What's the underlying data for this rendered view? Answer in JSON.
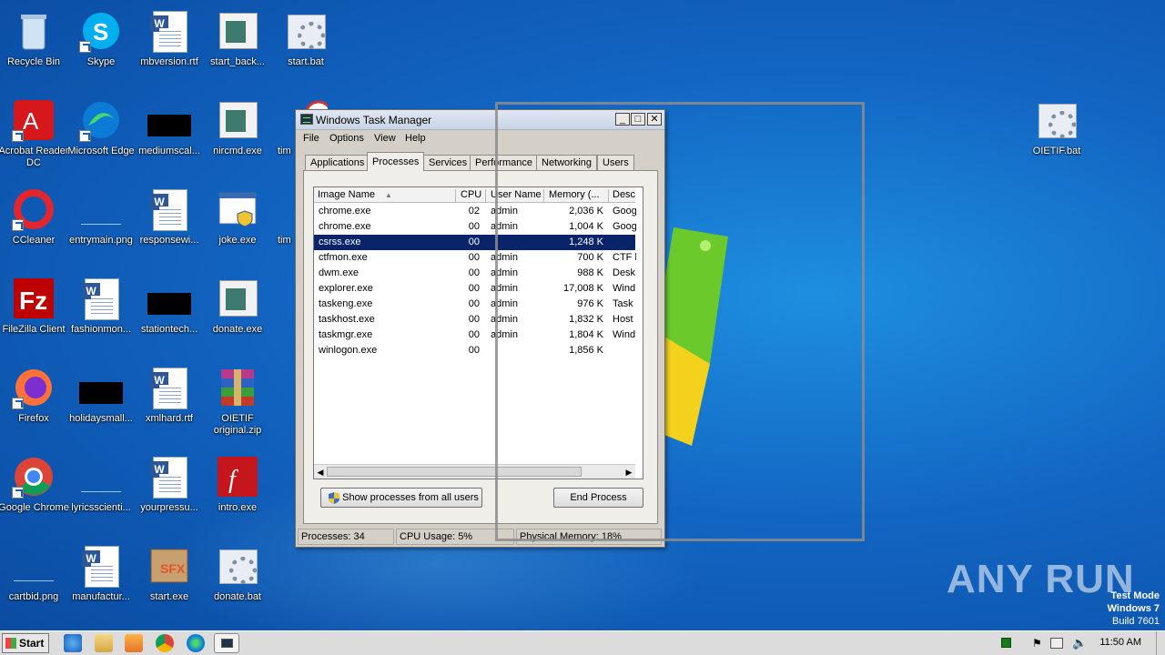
{
  "desktop": {
    "icons": [
      {
        "label": "Recycle Bin",
        "icon": "recycle-bin-icon"
      },
      {
        "label": "Skype",
        "icon": "skype-icon"
      },
      {
        "label": "mbversion.rtf",
        "icon": "word-document-icon"
      },
      {
        "label": "start_back...",
        "icon": "image-file-icon"
      },
      {
        "label": "start.bat",
        "icon": "batch-file-icon"
      },
      {
        "label": "Acrobat Reader DC",
        "icon": "acrobat-icon"
      },
      {
        "label": "Microsoft Edge",
        "icon": "edge-icon"
      },
      {
        "label": "mediumscal...",
        "icon": "black-image-icon"
      },
      {
        "label": "nircmd.exe",
        "icon": "image-file-icon"
      },
      {
        "label": "tim",
        "icon": "clock-icon"
      },
      {
        "label": "CCleaner",
        "icon": "ccleaner-icon"
      },
      {
        "label": "entrymain.png",
        "icon": "png-file-icon"
      },
      {
        "label": "responsewi...",
        "icon": "word-document-icon"
      },
      {
        "label": "joke.exe",
        "icon": "exe-shield-icon"
      },
      {
        "label": "tim",
        "icon": "exe-icon"
      },
      {
        "label": "FileZilla Client",
        "icon": "filezilla-icon"
      },
      {
        "label": "fashionmon...",
        "icon": "word-document-icon"
      },
      {
        "label": "stationtech...",
        "icon": "black-image-icon"
      },
      {
        "label": "donate.exe",
        "icon": "image-file-icon"
      },
      {
        "label": "Firefox",
        "icon": "firefox-icon"
      },
      {
        "label": "holidaysmall...",
        "icon": "black-image-icon"
      },
      {
        "label": "xmlhard.rtf",
        "icon": "word-document-icon"
      },
      {
        "label": "OIETIF original.zip",
        "icon": "winrar-icon"
      },
      {
        "label": "Google Chrome",
        "icon": "chrome-icon"
      },
      {
        "label": "lyricsscienti...",
        "icon": "png-file-icon"
      },
      {
        "label": "yourpressu...",
        "icon": "word-document-icon"
      },
      {
        "label": "intro.exe",
        "icon": "flash-icon"
      },
      {
        "label": "cartbid.png",
        "icon": "png-file-icon"
      },
      {
        "label": "manufactur...",
        "icon": "word-document-icon"
      },
      {
        "label": "start.exe",
        "icon": "sfx-archive-icon"
      },
      {
        "label": "donate.bat",
        "icon": "batch-file-icon"
      },
      {
        "label": "OIETIF.bat",
        "icon": "batch-file-icon"
      }
    ]
  },
  "taskmanager": {
    "title": "Windows Task Manager",
    "menu": [
      "File",
      "Options",
      "View",
      "Help"
    ],
    "tabs": [
      "Applications",
      "Processes",
      "Services",
      "Performance",
      "Networking",
      "Users"
    ],
    "active_tab": "Processes",
    "columns": [
      "Image Name",
      "CPU",
      "User Name",
      "Memory (...",
      "Desc"
    ],
    "rows": [
      {
        "name": "chrome.exe",
        "cpu": "02",
        "user": "admin",
        "mem": "2,036 K",
        "desc": "Goog"
      },
      {
        "name": "chrome.exe",
        "cpu": "00",
        "user": "admin",
        "mem": "1,004 K",
        "desc": "Goog"
      },
      {
        "name": "csrss.exe",
        "cpu": "00",
        "user": "",
        "mem": "1,248 K",
        "desc": ""
      },
      {
        "name": "ctfmon.exe",
        "cpu": "00",
        "user": "admin",
        "mem": "700 K",
        "desc": "CTF l"
      },
      {
        "name": "dwm.exe",
        "cpu": "00",
        "user": "admin",
        "mem": "988 K",
        "desc": "Desk"
      },
      {
        "name": "explorer.exe",
        "cpu": "00",
        "user": "admin",
        "mem": "17,008 K",
        "desc": "Wind"
      },
      {
        "name": "taskeng.exe",
        "cpu": "00",
        "user": "admin",
        "mem": "976 K",
        "desc": "Task"
      },
      {
        "name": "taskhost.exe",
        "cpu": "00",
        "user": "admin",
        "mem": "1,832 K",
        "desc": "Host"
      },
      {
        "name": "taskmgr.exe",
        "cpu": "00",
        "user": "admin",
        "mem": "1,804 K",
        "desc": "Wind"
      },
      {
        "name": "winlogon.exe",
        "cpu": "00",
        "user": "",
        "mem": "1,856 K",
        "desc": ""
      }
    ],
    "show_all_label": "Show processes from all users",
    "end_process_label": "End Process",
    "status": {
      "processes": "Processes: 34",
      "cpu": "CPU Usage: 5%",
      "memory": "Physical Memory: 18%"
    }
  },
  "watermark": {
    "brand": "ANY RUN",
    "mode": "Test Mode",
    "os": "Windows 7",
    "build": "Build 7601"
  },
  "taskbar": {
    "start_label": "Start",
    "clock": "11:50 AM"
  }
}
